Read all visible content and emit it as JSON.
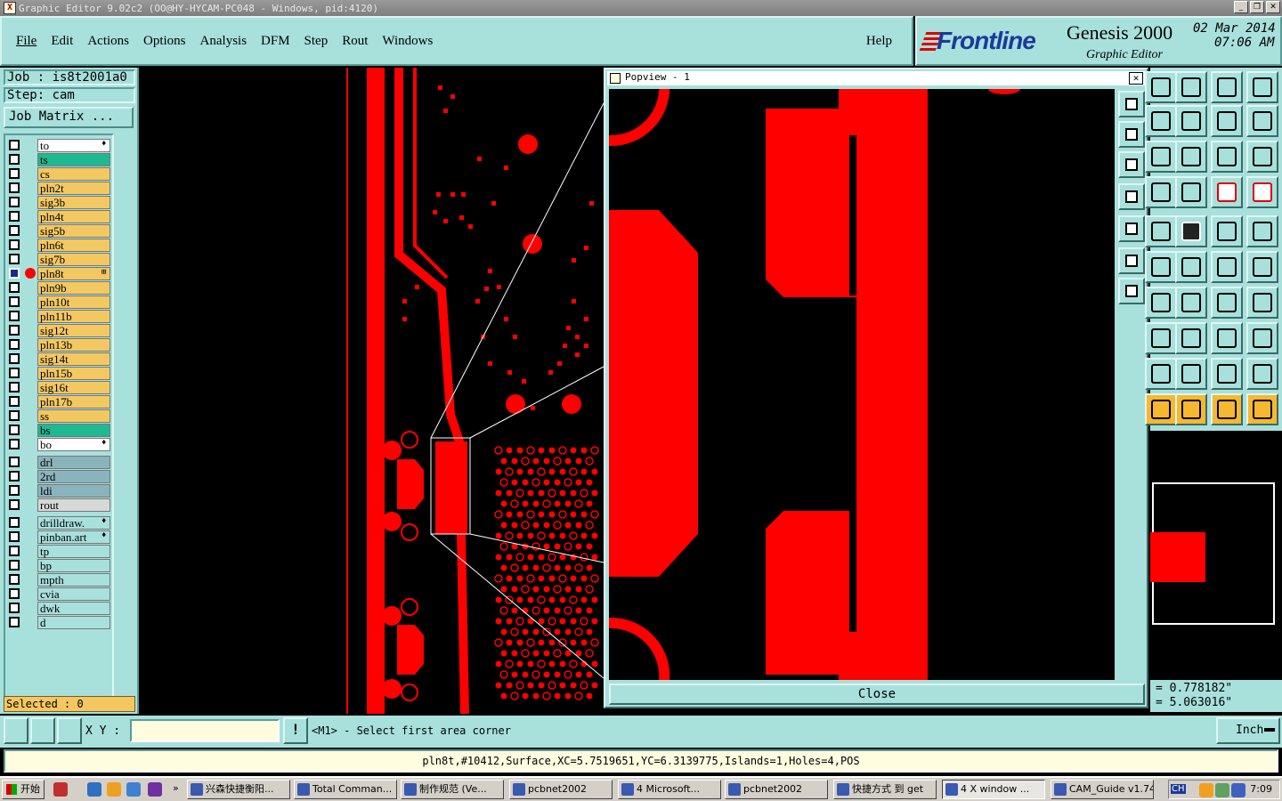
{
  "window": {
    "title": "Graphic Editor 9.02c2 (OO@HY-HYCAM-PC048 - Windows, pid:4120)",
    "controls": [
      "_",
      "❐",
      "✕"
    ]
  },
  "menu": {
    "items": [
      "File",
      "Edit",
      "Actions",
      "Options",
      "Analysis",
      "DFM",
      "Step",
      "Rout",
      "Windows"
    ],
    "help": "Help"
  },
  "brand": {
    "logo_text": "Frontline",
    "product": "Genesis 2000",
    "subtitle": "Graphic Editor",
    "date": "02 Mar 2014",
    "time": "07:06 AM"
  },
  "job": {
    "job_label": "Job : is8t2001a0",
    "step_label": "Step: cam",
    "matrix_button": "Job Matrix ...",
    "selected": "Selected : 0"
  },
  "layers": {
    "board": [
      {
        "name": "to",
        "color": "#ffffff",
        "flag": "♦"
      },
      {
        "name": "ts",
        "color": "#20b890",
        "flag": ""
      },
      {
        "name": "cs",
        "color": "#f4c860",
        "flag": ""
      },
      {
        "name": "pln2t",
        "color": "#f4c860",
        "flag": ""
      },
      {
        "name": "sig3b",
        "color": "#f4c860",
        "flag": ""
      },
      {
        "name": "pln4t",
        "color": "#f4c860",
        "flag": ""
      },
      {
        "name": "sig5b",
        "color": "#f4c860",
        "flag": ""
      },
      {
        "name": "pln6t",
        "color": "#f4c860",
        "flag": ""
      },
      {
        "name": "sig7b",
        "color": "#f4c860",
        "flag": ""
      },
      {
        "name": "pln8t",
        "color": "#f4c860",
        "flag": "⊞",
        "active": true
      },
      {
        "name": "pln9b",
        "color": "#f4c860",
        "flag": ""
      },
      {
        "name": "pln10t",
        "color": "#f4c860",
        "flag": ""
      },
      {
        "name": "pln11b",
        "color": "#f4c860",
        "flag": ""
      },
      {
        "name": "sig12t",
        "color": "#f4c860",
        "flag": ""
      },
      {
        "name": "pln13b",
        "color": "#f4c860",
        "flag": ""
      },
      {
        "name": "sig14t",
        "color": "#f4c860",
        "flag": ""
      },
      {
        "name": "pln15b",
        "color": "#f4c860",
        "flag": ""
      },
      {
        "name": "sig16t",
        "color": "#f4c860",
        "flag": ""
      },
      {
        "name": "pln17b",
        "color": "#f4c860",
        "flag": ""
      },
      {
        "name": "ss",
        "color": "#f4c860",
        "flag": ""
      },
      {
        "name": "bs",
        "color": "#20b890",
        "flag": ""
      },
      {
        "name": "bo",
        "color": "#ffffff",
        "flag": "♦"
      }
    ],
    "drill": [
      {
        "name": "drl",
        "color": "#8ab4bc",
        "flag": ""
      },
      {
        "name": "2rd",
        "color": "#8ab4bc",
        "flag": ""
      },
      {
        "name": "ldi",
        "color": "#8ab4bc",
        "flag": ""
      },
      {
        "name": "rout",
        "color": "#d8d8d8",
        "flag": ""
      }
    ],
    "misc": [
      {
        "name": "drilldraw.",
        "color": "#a8e0dc",
        "flag": "♦"
      },
      {
        "name": "pinban.art",
        "color": "#a8e0dc",
        "flag": "♦"
      },
      {
        "name": "tp",
        "color": "#a8e0dc",
        "flag": ""
      },
      {
        "name": "bp",
        "color": "#a8e0dc",
        "flag": ""
      },
      {
        "name": "mpth",
        "color": "#a8e0dc",
        "flag": ""
      },
      {
        "name": "cvia",
        "color": "#a8e0dc",
        "flag": ""
      },
      {
        "name": "dwk",
        "color": "#a8e0dc",
        "flag": ""
      },
      {
        "name": "d",
        "color": "#a8e0dc",
        "flag": ""
      }
    ]
  },
  "popview": {
    "title": "Popview - 1",
    "close_icon": "✕",
    "close_button": "Close"
  },
  "coords": {
    "x": "= 0.778182\"",
    "y": "= 5.063016\""
  },
  "bottom": {
    "xy_label": "X Y :",
    "xy_value": "",
    "alert_icon": "!",
    "prompt": "<M1> - Select first area corner",
    "units": "Inch"
  },
  "status_line": "pln8t,#10412,Surface,XC=5.7519651,YC=6.3139775,Islands=1,Holes=4,POS",
  "taskbar": {
    "start": "开始",
    "chevron": "»",
    "items": [
      {
        "label": "兴森快捷衡阳...",
        "active": false
      },
      {
        "label": "Total Comman...",
        "active": false
      },
      {
        "label": "制作规范 (Ve...",
        "active": false
      },
      {
        "label": "pcbnet2002",
        "active": false
      },
      {
        "label": "4 Microsoft...",
        "active": false
      },
      {
        "label": "pcbnet2002",
        "active": false
      },
      {
        "label": "快捷方式 到 get",
        "active": false
      },
      {
        "label": "4 X window ...",
        "active": true
      },
      {
        "label": "CAM_Guide v1.74",
        "active": false
      }
    ],
    "tray_lang": "CH",
    "clock": "7:09"
  },
  "colors": {
    "panel": "#a8e0dc",
    "feature": "#ff0000",
    "canvas": "#000000"
  }
}
